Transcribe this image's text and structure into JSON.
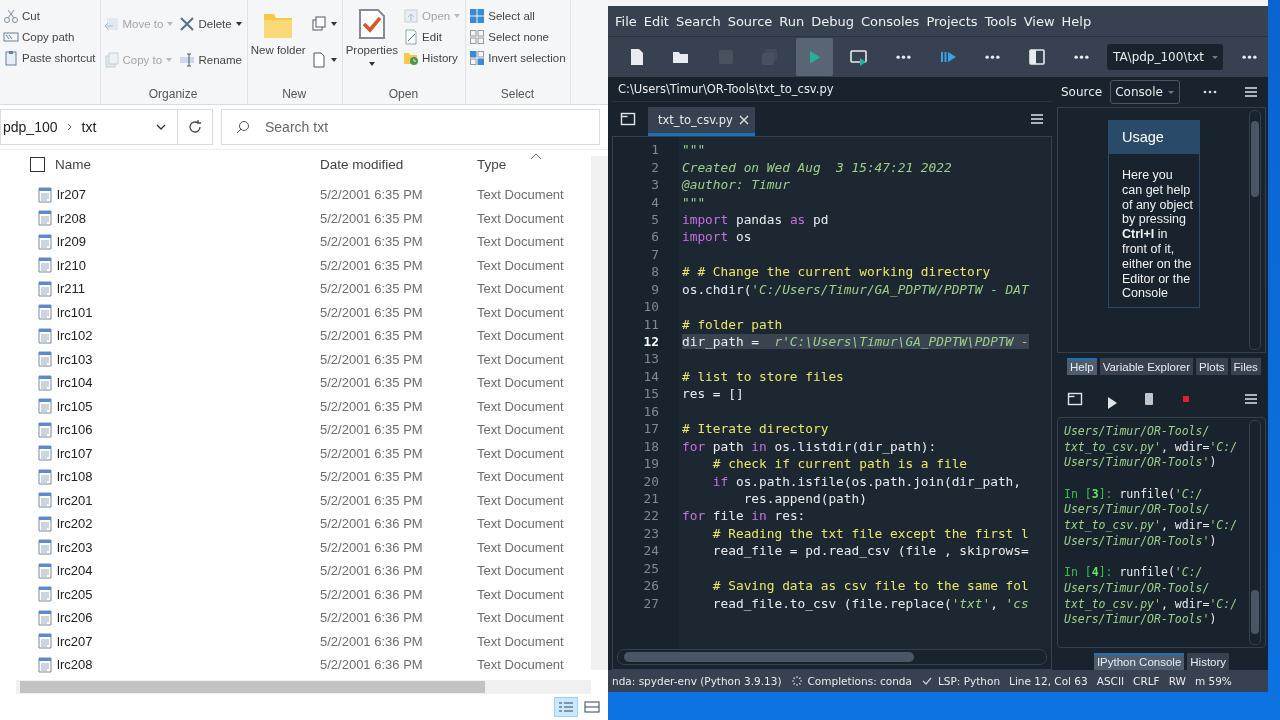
{
  "explorer": {
    "ribbon": [
      {
        "columns": [
          [
            {
              "kind": "small",
              "label": "Cut",
              "disabled": false,
              "dropdown": false
            },
            {
              "kind": "small",
              "label": "Copy path",
              "disabled": false,
              "dropdown": false
            },
            {
              "kind": "small",
              "label": "Paste shortcut",
              "disabled": false,
              "dropdown": false
            }
          ]
        ]
      },
      {
        "label": "Organize",
        "columns": [
          [
            {
              "kind": "small",
              "label": "Move to",
              "disabled": true,
              "dropdown": true
            },
            {
              "kind": "small",
              "label": "Copy to",
              "disabled": true,
              "dropdown": true
            }
          ],
          [
            {
              "kind": "small",
              "label": "Delete",
              "disabled": false,
              "dropdown": true
            },
            {
              "kind": "small",
              "label": "Rename",
              "disabled": false,
              "dropdown": false
            }
          ]
        ]
      },
      {
        "label": "New",
        "columns": [
          [
            {
              "kind": "large",
              "label": "New folder",
              "disabled": false,
              "dropdown": false
            }
          ],
          [
            {
              "kind": "small",
              "disabled": false,
              "dropdown": true
            },
            {
              "kind": "small",
              "disabled": false,
              "dropdown": true
            }
          ]
        ]
      },
      {
        "label": "Open",
        "columns": [
          [
            {
              "kind": "large",
              "label": "Properties",
              "disabled": false,
              "dropdown": true
            }
          ],
          [
            {
              "kind": "small",
              "label": "Open",
              "disabled": true,
              "dropdown": true
            },
            {
              "kind": "small",
              "label": "Edit",
              "disabled": false,
              "dropdown": false
            },
            {
              "kind": "small",
              "label": "History",
              "disabled": false,
              "dropdown": false
            }
          ]
        ]
      },
      {
        "label": "Select",
        "columns": [
          [
            {
              "kind": "small",
              "label": "Select all",
              "disabled": false,
              "dropdown": false
            },
            {
              "kind": "small",
              "label": "Select none",
              "disabled": false,
              "dropdown": false
            },
            {
              "kind": "small",
              "label": "Invert selection",
              "disabled": false,
              "dropdown": false
            }
          ]
        ]
      }
    ],
    "crumbs": [
      "pdp_100",
      "txt"
    ],
    "search": {
      "placeholder": "Search txt"
    },
    "select_all_checked": false,
    "columns": [
      "Name",
      "Date modified",
      "Type"
    ],
    "files": [
      {
        "name": "lr207",
        "date": "5/2/2001 6:35 PM",
        "type": "Text Document"
      },
      {
        "name": "lr208",
        "date": "5/2/2001 6:35 PM",
        "type": "Text Document"
      },
      {
        "name": "lr209",
        "date": "5/2/2001 6:35 PM",
        "type": "Text Document"
      },
      {
        "name": "lr210",
        "date": "5/2/2001 6:35 PM",
        "type": "Text Document"
      },
      {
        "name": "lr211",
        "date": "5/2/2001 6:35 PM",
        "type": "Text Document"
      },
      {
        "name": "lrc101",
        "date": "5/2/2001 6:35 PM",
        "type": "Text Document"
      },
      {
        "name": "lrc102",
        "date": "5/2/2001 6:35 PM",
        "type": "Text Document"
      },
      {
        "name": "lrc103",
        "date": "5/2/2001 6:35 PM",
        "type": "Text Document"
      },
      {
        "name": "lrc104",
        "date": "5/2/2001 6:35 PM",
        "type": "Text Document"
      },
      {
        "name": "lrc105",
        "date": "5/2/2001 6:35 PM",
        "type": "Text Document"
      },
      {
        "name": "lrc106",
        "date": "5/2/2001 6:35 PM",
        "type": "Text Document"
      },
      {
        "name": "lrc107",
        "date": "5/2/2001 6:35 PM",
        "type": "Text Document"
      },
      {
        "name": "lrc108",
        "date": "5/2/2001 6:35 PM",
        "type": "Text Document"
      },
      {
        "name": "lrc201",
        "date": "5/2/2001 6:35 PM",
        "type": "Text Document"
      },
      {
        "name": "lrc202",
        "date": "5/2/2001 6:36 PM",
        "type": "Text Document"
      },
      {
        "name": "lrc203",
        "date": "5/2/2001 6:36 PM",
        "type": "Text Document"
      },
      {
        "name": "lrc204",
        "date": "5/2/2001 6:36 PM",
        "type": "Text Document"
      },
      {
        "name": "lrc205",
        "date": "5/2/2001 6:36 PM",
        "type": "Text Document"
      },
      {
        "name": "lrc206",
        "date": "5/2/2001 6:36 PM",
        "type": "Text Document"
      },
      {
        "name": "lrc207",
        "date": "5/2/2001 6:36 PM",
        "type": "Text Document"
      },
      {
        "name": "lrc208",
        "date": "5/2/2001 6:36 PM",
        "type": "Text Document"
      }
    ],
    "views": [
      {
        "kind": "details",
        "selected": true
      },
      {
        "kind": "tiles",
        "selected": false
      }
    ]
  },
  "spyder": {
    "menu": [
      "File",
      "Edit",
      "Search",
      "Source",
      "Run",
      "Debug",
      "Consoles",
      "Projects",
      "Tools",
      "View",
      "Help"
    ],
    "toolbar": [
      {
        "kind": "new",
        "disabled": false,
        "hovered": false
      },
      {
        "kind": "open",
        "disabled": false,
        "hovered": false
      },
      {
        "kind": "save",
        "disabled": true,
        "hovered": false
      },
      {
        "kind": "saveall",
        "disabled": true,
        "hovered": false
      },
      {
        "kind": "run",
        "disabled": false,
        "hovered": true
      },
      {
        "kind": "runcell",
        "disabled": false,
        "hovered": false
      },
      {
        "kind": "more",
        "disabled": false,
        "hovered": false
      },
      {
        "kind": "debug",
        "disabled": false,
        "hovered": false
      },
      {
        "kind": "more",
        "disabled": false,
        "hovered": false
      },
      {
        "kind": "pane",
        "disabled": false,
        "hovered": false
      },
      {
        "kind": "more",
        "disabled": false,
        "hovered": false
      },
      {
        "kind": "path",
        "value": "TA\\pdp_100\\txt"
      },
      {
        "kind": "more",
        "disabled": false,
        "hovered": false
      }
    ],
    "file_path": "C:\\Users\\Timur\\OR-Tools\\txt_to_csv.py",
    "tabs": [
      {
        "label": "txt_to_csv.py",
        "selected": true
      }
    ],
    "code": [
      {
        "n": "1",
        "selected": false,
        "segs": [
          {
            "kind": "doc",
            "t": "\"\"\""
          }
        ]
      },
      {
        "n": "2",
        "selected": false,
        "segs": [
          {
            "kind": "doc",
            "t": "Created on Wed Aug  3 15:47:21 2022"
          }
        ]
      },
      {
        "n": "3",
        "selected": false,
        "segs": [
          {
            "kind": "doc",
            "t": "@author: Timur"
          }
        ]
      },
      {
        "n": "4",
        "selected": false,
        "segs": [
          {
            "kind": "doc",
            "t": "\"\"\""
          }
        ]
      },
      {
        "n": "5",
        "selected": false,
        "segs": [
          {
            "kind": "kw",
            "t": "import"
          },
          {
            "kind": "plain",
            "t": " pandas "
          },
          {
            "kind": "kw",
            "t": "as"
          },
          {
            "kind": "plain",
            "t": " pd"
          }
        ]
      },
      {
        "n": "6",
        "selected": false,
        "segs": [
          {
            "kind": "kw",
            "t": "import"
          },
          {
            "kind": "plain",
            "t": " os"
          }
        ]
      },
      {
        "n": "7",
        "selected": false
      },
      {
        "n": "8",
        "selected": false,
        "segs": [
          {
            "kind": "cm",
            "t": "# # Change the current working directory"
          }
        ]
      },
      {
        "n": "9",
        "selected": false,
        "segs": [
          {
            "kind": "plain",
            "t": "os.chdir("
          },
          {
            "kind": "str",
            "t": "'C:/Users/Timur/GA_PDPTW/PDPTW - DAT"
          }
        ]
      },
      {
        "n": "10",
        "selected": false
      },
      {
        "n": "11",
        "selected": false,
        "segs": [
          {
            "kind": "cm",
            "t": "# folder path"
          }
        ]
      },
      {
        "n": "12",
        "selected": true,
        "segs": [
          {
            "kind": "plain",
            "t": "dir_path =  "
          },
          {
            "kind": "str",
            "t": "r'C:\\Users\\Timur\\GA_PDPTW\\PDPTW -"
          }
        ]
      },
      {
        "n": "13",
        "selected": false
      },
      {
        "n": "14",
        "selected": false,
        "segs": [
          {
            "kind": "cm",
            "t": "# list to store files"
          }
        ]
      },
      {
        "n": "15",
        "selected": false,
        "segs": [
          {
            "kind": "plain",
            "t": "res = []"
          }
        ]
      },
      {
        "n": "16",
        "selected": false
      },
      {
        "n": "17",
        "selected": false,
        "segs": [
          {
            "kind": "cm",
            "t": "# Iterate directory"
          }
        ]
      },
      {
        "n": "18",
        "selected": false,
        "segs": [
          {
            "kind": "kw",
            "t": "for"
          },
          {
            "kind": "plain",
            "t": " path "
          },
          {
            "kind": "kw",
            "t": "in"
          },
          {
            "kind": "plain",
            "t": " os.listdir(dir_path):"
          }
        ]
      },
      {
        "n": "19",
        "selected": false,
        "segs": [
          {
            "kind": "cm",
            "t": "    # check if current path is a file"
          }
        ]
      },
      {
        "n": "20",
        "selected": false,
        "segs": [
          {
            "kind": "kw",
            "t": "    if"
          },
          {
            "kind": "plain",
            "t": " os.path.isfile(os.path.join(dir_path,"
          }
        ]
      },
      {
        "n": "21",
        "selected": false,
        "segs": [
          {
            "kind": "plain",
            "t": "        res.append(path)"
          }
        ]
      },
      {
        "n": "22",
        "selected": false,
        "segs": [
          {
            "kind": "kw",
            "t": "for"
          },
          {
            "kind": "plain",
            "t": " file "
          },
          {
            "kind": "kw",
            "t": "in"
          },
          {
            "kind": "plain",
            "t": " res:"
          }
        ]
      },
      {
        "n": "23",
        "selected": false,
        "segs": [
          {
            "kind": "cm",
            "t": "    # Reading the txt file except the first l"
          }
        ]
      },
      {
        "n": "24",
        "selected": false,
        "segs": [
          {
            "kind": "plain",
            "t": "    read_file = pd.read_csv (file , skiprows="
          }
        ]
      },
      {
        "n": "25",
        "selected": false
      },
      {
        "n": "26",
        "selected": false,
        "segs": [
          {
            "kind": "cm",
            "t": "    # Saving data as csv file to the same fol"
          }
        ]
      },
      {
        "n": "27",
        "selected": false,
        "segs": [
          {
            "kind": "plain",
            "t": "    read_file.to_csv (file.replace("
          },
          {
            "kind": "str",
            "t": "'txt'"
          },
          {
            "kind": "plain",
            "t": ", "
          },
          {
            "kind": "str",
            "t": "'cs"
          }
        ]
      }
    ],
    "help": {
      "source_label": "Source",
      "source_value": "Console",
      "title": "Usage",
      "body": "Here you can get help of any object by pressing **Ctrl+I** in front of it, either on the Editor or the Console"
    },
    "help_tabs": [
      {
        "label": "Help",
        "selected": true
      },
      {
        "label": "Variable Explorer",
        "selected": false
      },
      {
        "label": "Plots",
        "selected": false
      },
      {
        "label": "Files",
        "selected": false
      }
    ],
    "console": [
      [
        [
          {
            "kind": "str",
            "t": "Users/Timur/OR-Tools/"
          }
        ],
        [
          {
            "kind": "str",
            "t": "txt_to_csv.py'"
          },
          {
            "kind": "plain",
            "t": ", wdir="
          },
          {
            "kind": "str",
            "t": "'C:/"
          }
        ],
        [
          {
            "kind": "str",
            "t": "Users/Timur/OR-Tools'"
          },
          {
            "kind": "plain",
            "t": ")"
          }
        ]
      ],
      [
        [
          {
            "kind": "prompt",
            "t": "In ["
          },
          {
            "kind": "num",
            "t": "3"
          },
          {
            "kind": "prompt",
            "t": "]: "
          },
          {
            "kind": "plain",
            "t": "runfile("
          },
          {
            "kind": "str",
            "t": "'C:/"
          }
        ],
        [
          {
            "kind": "str",
            "t": "Users/Timur/OR-Tools/"
          }
        ],
        [
          {
            "kind": "str",
            "t": "txt_to_csv.py'"
          },
          {
            "kind": "plain",
            "t": ", wdir="
          },
          {
            "kind": "str",
            "t": "'C:/"
          }
        ],
        [
          {
            "kind": "str",
            "t": "Users/Timur/OR-Tools'"
          },
          {
            "kind": "plain",
            "t": ")"
          }
        ]
      ],
      [
        [
          {
            "kind": "prompt",
            "t": "In ["
          },
          {
            "kind": "num",
            "t": "4"
          },
          {
            "kind": "prompt",
            "t": "]: "
          },
          {
            "kind": "plain",
            "t": "runfile("
          },
          {
            "kind": "str",
            "t": "'C:/"
          }
        ],
        [
          {
            "kind": "str",
            "t": "Users/Timur/OR-Tools/"
          }
        ],
        [
          {
            "kind": "str",
            "t": "txt_to_csv.py'"
          },
          {
            "kind": "plain",
            "t": ", wdir="
          },
          {
            "kind": "str",
            "t": "'C:/"
          }
        ],
        [
          {
            "kind": "str",
            "t": "Users/Timur/OR-Tools'"
          },
          {
            "kind": "plain",
            "t": ")"
          }
        ]
      ]
    ],
    "console_tabs": [
      {
        "label": "IPython Console",
        "selected": true
      },
      {
        "label": "History",
        "selected": false
      }
    ],
    "status": [
      {
        "kind": "text",
        "t": "nda: spyder-env (Python 3.9.13)"
      },
      {
        "kind": "spin",
        "t": "Completions: conda"
      },
      {
        "kind": "check",
        "t": "LSP: Python"
      },
      {
        "kind": "text",
        "t": "Line 12, Col 63"
      },
      {
        "kind": "text",
        "t": "ASCII"
      },
      {
        "kind": "text",
        "t": "CRLF"
      },
      {
        "kind": "text",
        "t": "RW"
      },
      {
        "kind": "text",
        "t": "m 59%"
      }
    ]
  }
}
